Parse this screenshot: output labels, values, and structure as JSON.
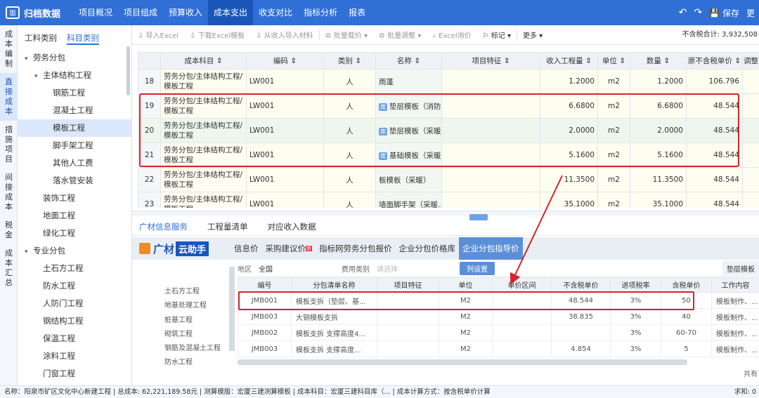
{
  "app": {
    "title": "归档数据",
    "nav": [
      "项目概况",
      "项目组成",
      "预算收入",
      "成本支出",
      "收支对比",
      "指标分析",
      "报表"
    ],
    "active_nav": "成本支出",
    "save_label": "保存",
    "more_right": "更"
  },
  "vtabs": [
    {
      "label": "成本编制",
      "active": false
    },
    {
      "label": "直接成本",
      "active": true
    },
    {
      "label": "措施项目",
      "active": false
    },
    {
      "label": "间接成本",
      "active": false
    },
    {
      "label": "税金",
      "active": false
    },
    {
      "label": "成本汇总",
      "active": false
    }
  ],
  "tree": {
    "tabs": [
      "工料类别",
      "科目类别"
    ],
    "nodes": [
      {
        "label": "劳务分包",
        "level": 0,
        "caret": "▾"
      },
      {
        "label": "主体结构工程",
        "level": 1,
        "caret": "▾"
      },
      {
        "label": "钢筋工程",
        "level": 2
      },
      {
        "label": "混凝土工程",
        "level": 2
      },
      {
        "label": "模板工程",
        "level": 2,
        "active": true
      },
      {
        "label": "脚手架工程",
        "level": 2
      },
      {
        "label": "其他人工费",
        "level": 2
      },
      {
        "label": "落水管安装",
        "level": 2
      },
      {
        "label": "装饰工程",
        "level": 1
      },
      {
        "label": "地面工程",
        "level": 1
      },
      {
        "label": "绿化工程",
        "level": 1
      },
      {
        "label": "专业分包",
        "level": 0,
        "caret": "▾"
      },
      {
        "label": "土石方工程",
        "level": 1
      },
      {
        "label": "防水工程",
        "level": 1
      },
      {
        "label": "人防门工程",
        "level": 1
      },
      {
        "label": "钢结构工程",
        "level": 1
      },
      {
        "label": "保温工程",
        "level": 1
      },
      {
        "label": "涂料工程",
        "level": 1
      },
      {
        "label": "门窗工程",
        "level": 1
      }
    ]
  },
  "toolbar": {
    "buttons": [
      "导入Excel",
      "下载Excel模板",
      "从收入导入材料",
      "批量载价",
      "批量调整",
      "Excel询价",
      "标记",
      "更多"
    ],
    "total": "不含税合计: 3,932,508"
  },
  "grid": {
    "columns": [
      "",
      "成本科目",
      "编码",
      "类别",
      "名称",
      "项目特征",
      "收入工程量",
      "单位",
      "数量",
      "原不含税单价",
      "调整"
    ],
    "rows": [
      {
        "idx": "18",
        "subject": "劳务分包/主体结构工程/模板工程",
        "code": "LW001",
        "type": "人",
        "name": "雨蓬",
        "lib": false,
        "feature": "",
        "qty_in": "1.2000",
        "unit": "m2",
        "qty": "1.2000",
        "price": "106.796"
      },
      {
        "idx": "19",
        "subject": "劳务分包/主体结构工程/模板工程",
        "code": "LW001",
        "type": "人",
        "name": "垫层模板（消防...",
        "lib": true,
        "feature": "",
        "qty_in": "6.6800",
        "unit": "m2",
        "qty": "6.6800",
        "price": "48.544"
      },
      {
        "idx": "20",
        "subject": "劳务分包/主体结构工程/模板工程",
        "code": "LW001",
        "type": "人",
        "name": "垫层模板（采暖...",
        "lib": true,
        "feature": "",
        "qty_in": "2.0000",
        "unit": "m2",
        "qty": "2.0000",
        "price": "48.544",
        "selected": true
      },
      {
        "idx": "21",
        "subject": "劳务分包/主体结构工程/模板工程",
        "code": "LW001",
        "type": "人",
        "name": "基础模板（采暖...",
        "lib": true,
        "feature": "",
        "qty_in": "5.1600",
        "unit": "m2",
        "qty": "5.1600",
        "price": "48.544"
      },
      {
        "idx": "22",
        "subject": "劳务分包/主体结构工程/模板工程",
        "code": "LW001",
        "type": "人",
        "name": "板模板（采暖）",
        "lib": false,
        "feature": "",
        "qty_in": "11.3500",
        "unit": "m2",
        "qty": "11.3500",
        "price": "48.544"
      },
      {
        "idx": "23",
        "subject": "劳务分包/主体结构工程/模板工程",
        "code": "LW001",
        "type": "人",
        "name": "墙面脚手架（采暖...",
        "lib": false,
        "feature": "",
        "qty_in": "35.1000",
        "unit": "m2",
        "qty": "35.1000",
        "price": "48.544"
      }
    ],
    "lib_tag": "库"
  },
  "bottom_tabs": [
    "广材信息服务",
    "工程量清单",
    "对应收入数据"
  ],
  "banner": {
    "logo_a": "广材",
    "logo_b": "云助手",
    "services": [
      "信息价",
      "采购建议价",
      "指标网劳务分包报价",
      "企业分包价格库",
      "企业分包指导价"
    ],
    "new_tag": "新",
    "active": "企业分包指导价"
  },
  "filters": {
    "region_label": "地区",
    "region_value": "全国",
    "cost_label": "费用类别",
    "cost_placeholder": "请选择",
    "config_button": "列设置",
    "right_tab": "垫层模板"
  },
  "categories": [
    "土石方工程",
    "地基处理工程",
    "桩基工程",
    "砌筑工程",
    "钢筋及混凝土工程",
    "防水工程"
  ],
  "btable": {
    "columns": [
      "编号",
      "分包清单名称",
      "项目特征",
      "单位",
      "单价区间",
      "不含税单价",
      "进项税率",
      "含税单价",
      "工作内容"
    ],
    "rows": [
      [
        "JMB001",
        "模板支拆（垫层、基...",
        "",
        "M2",
        "",
        "48.544",
        "3%",
        "50",
        "模板制作、..."
      ],
      [
        "JMB003",
        "大钢模板支拆",
        "",
        "M2",
        "",
        "38.835",
        "3%",
        "40",
        "模板制作、..."
      ],
      [
        "JMB002",
        "模板支拆 支撑高度4...",
        "",
        "M2",
        "",
        "",
        "3%",
        "60-70",
        "模板制作、..."
      ],
      [
        "JMB003",
        "模板支拆 支撑高度...",
        "",
        "M2",
        "",
        "4.854",
        "3%",
        "5",
        "模板制作、..."
      ]
    ],
    "more_col": "年",
    "total_label": "共有"
  },
  "status": {
    "text": "名称：阳泉市矿区文化中心新建工程  |  总成本: 62,221,189.58元  |  测算模版：宏厦三建测算模板  |  成本科目：宏厦三建科目库（...  |  成本计算方式：按含税单价计算",
    "right": "求和: 0"
  },
  "colors": {
    "primary": "#2f6fd6",
    "highlight": "#d9232b"
  }
}
